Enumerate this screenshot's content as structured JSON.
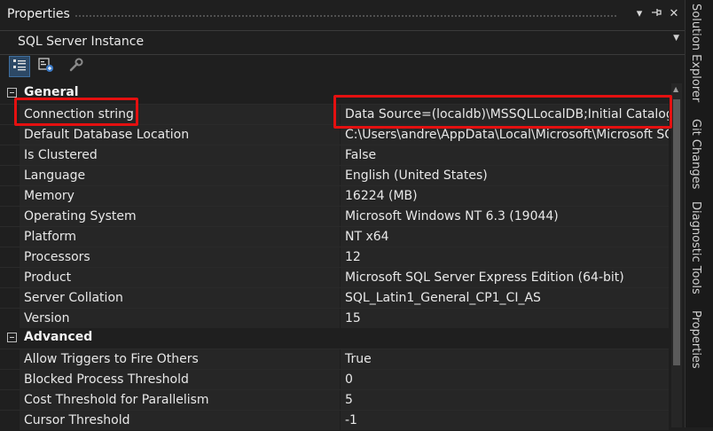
{
  "panel": {
    "title": "Properties",
    "object_selector": "SQL Server Instance"
  },
  "toolbar": {
    "buttons": [
      {
        "icon": "categorized-icon"
      },
      {
        "icon": "property-pages-icon"
      },
      {
        "icon": "wrench-icon"
      }
    ]
  },
  "categories": [
    {
      "label": "General",
      "properties": [
        {
          "name": "Connection string",
          "value": "Data Source=(localdb)\\MSSQLLocalDB;Initial Catalog="
        },
        {
          "name": "Default Database Location",
          "value": "C:\\Users\\andre\\AppData\\Local\\Microsoft\\Microsoft SQ"
        },
        {
          "name": "Is Clustered",
          "value": "False"
        },
        {
          "name": "Language",
          "value": "English (United States)"
        },
        {
          "name": "Memory",
          "value": "16224 (MB)"
        },
        {
          "name": "Operating System",
          "value": "Microsoft Windows NT 6.3 (19044)"
        },
        {
          "name": "Platform",
          "value": "NT x64"
        },
        {
          "name": "Processors",
          "value": "12"
        },
        {
          "name": "Product",
          "value": "Microsoft SQL Server Express Edition (64-bit)"
        },
        {
          "name": "Server Collation",
          "value": "SQL_Latin1_General_CP1_CI_AS"
        },
        {
          "name": "Version",
          "value": "15"
        }
      ]
    },
    {
      "label": "Advanced",
      "properties": [
        {
          "name": "Allow Triggers to Fire Others",
          "value": "True"
        },
        {
          "name": "Blocked Process Threshold",
          "value": "0"
        },
        {
          "name": "Cost Threshold for Parallelism",
          "value": "5"
        },
        {
          "name": "Cursor Threshold",
          "value": "-1"
        }
      ]
    }
  ],
  "side_tabs": [
    "Solution Explorer",
    "Git Changes",
    "Diagnostic Tools",
    "Properties"
  ],
  "colors": {
    "highlight": "#e41010",
    "accent": "#2d4966"
  }
}
